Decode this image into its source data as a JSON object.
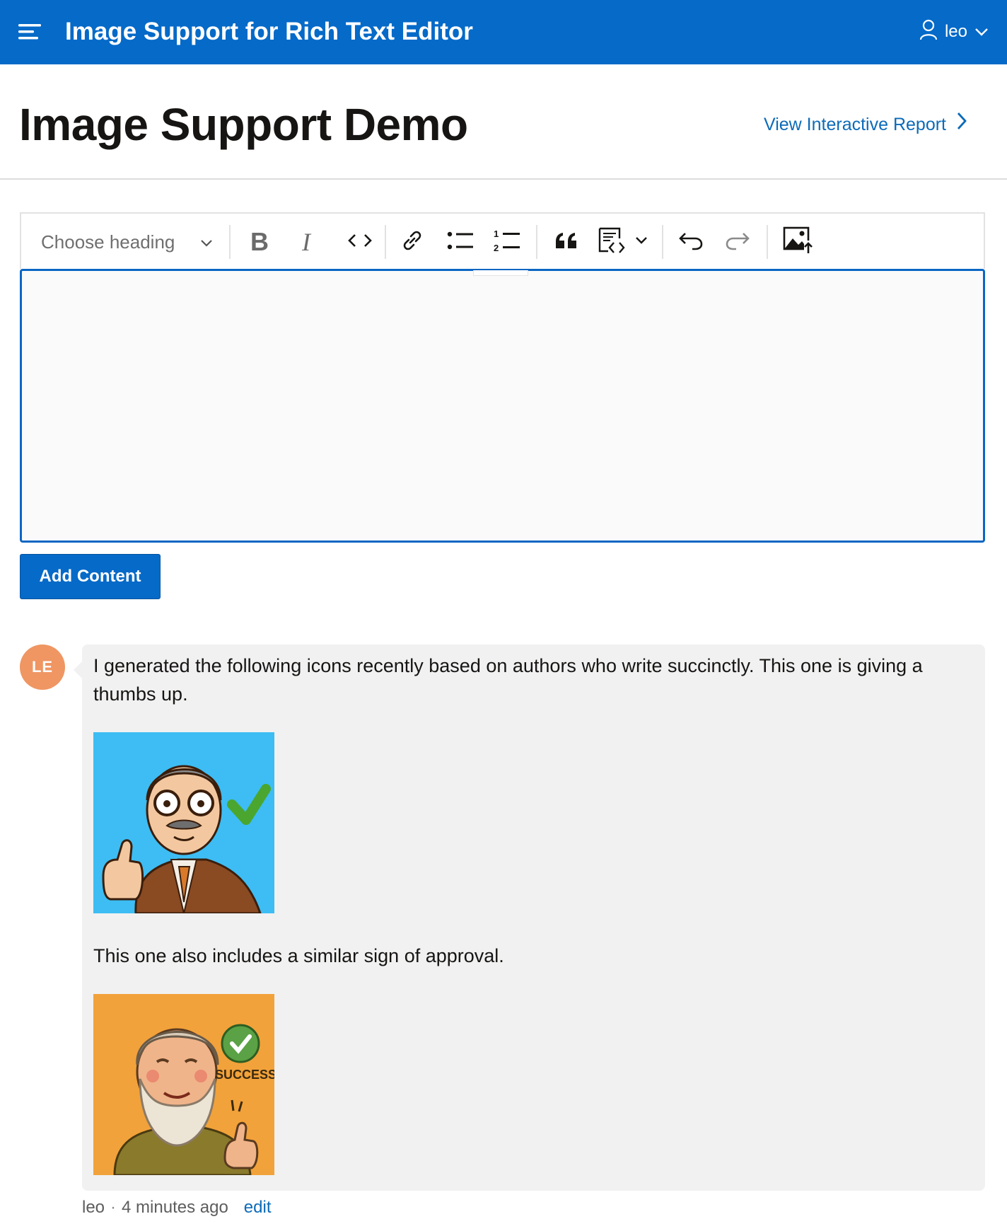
{
  "header": {
    "app_title": "Image Support for Rich Text Editor",
    "user_name": "leo",
    "background_color": "#056ac8"
  },
  "page": {
    "title": "Image Support Demo",
    "report_link": "View Interactive Report"
  },
  "editor": {
    "heading_placeholder": "Choose heading",
    "content": "",
    "toolbar_icons": [
      "bold-icon",
      "italic-icon",
      "code-icon",
      "link-icon",
      "bulleted-list-icon",
      "numbered-list-icon",
      "block-quote-icon",
      "code-block-icon",
      "undo-icon",
      "redo-icon",
      "image-upload-icon"
    ]
  },
  "actions": {
    "add_content_label": "Add Content"
  },
  "comment": {
    "avatar_initials": "LE",
    "avatar_color": "#ef9663",
    "paragraph_1": "I generated the following icons recently based on authors who write succinctly. This one is giving a thumbs up.",
    "paragraph_2": "This one also includes a similar sign of approval.",
    "image_2_caption": "SUCCESS!",
    "author": "leo",
    "separator": "·",
    "time": "4 minutes ago",
    "edit_label": "edit"
  }
}
